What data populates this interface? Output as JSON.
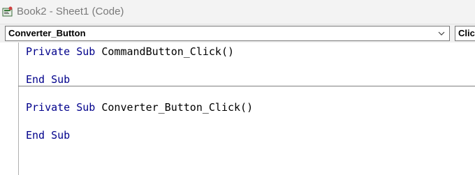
{
  "window": {
    "title": "Book2 - Sheet1 (Code)",
    "app_icon": "vba-code-window-icon"
  },
  "object_combo": {
    "selected": "Converter_Button",
    "arrow_icon": "chevron-down-icon"
  },
  "procedure_combo": {
    "selected": "Clic"
  },
  "code": {
    "blocks": [
      {
        "line1": {
          "keywords": [
            "Private",
            "Sub"
          ],
          "name": "CommandButton_Click()"
        },
        "end": {
          "keywords": [
            "End",
            "Sub"
          ]
        }
      },
      {
        "line1": {
          "keywords": [
            "Private",
            "Sub"
          ],
          "name": "Converter_Button_Click()"
        },
        "end": {
          "keywords": [
            "End",
            "Sub"
          ]
        }
      }
    ]
  },
  "colors": {
    "keyword": "#00008b",
    "text": "#000000",
    "title": "#7a7a7a"
  }
}
